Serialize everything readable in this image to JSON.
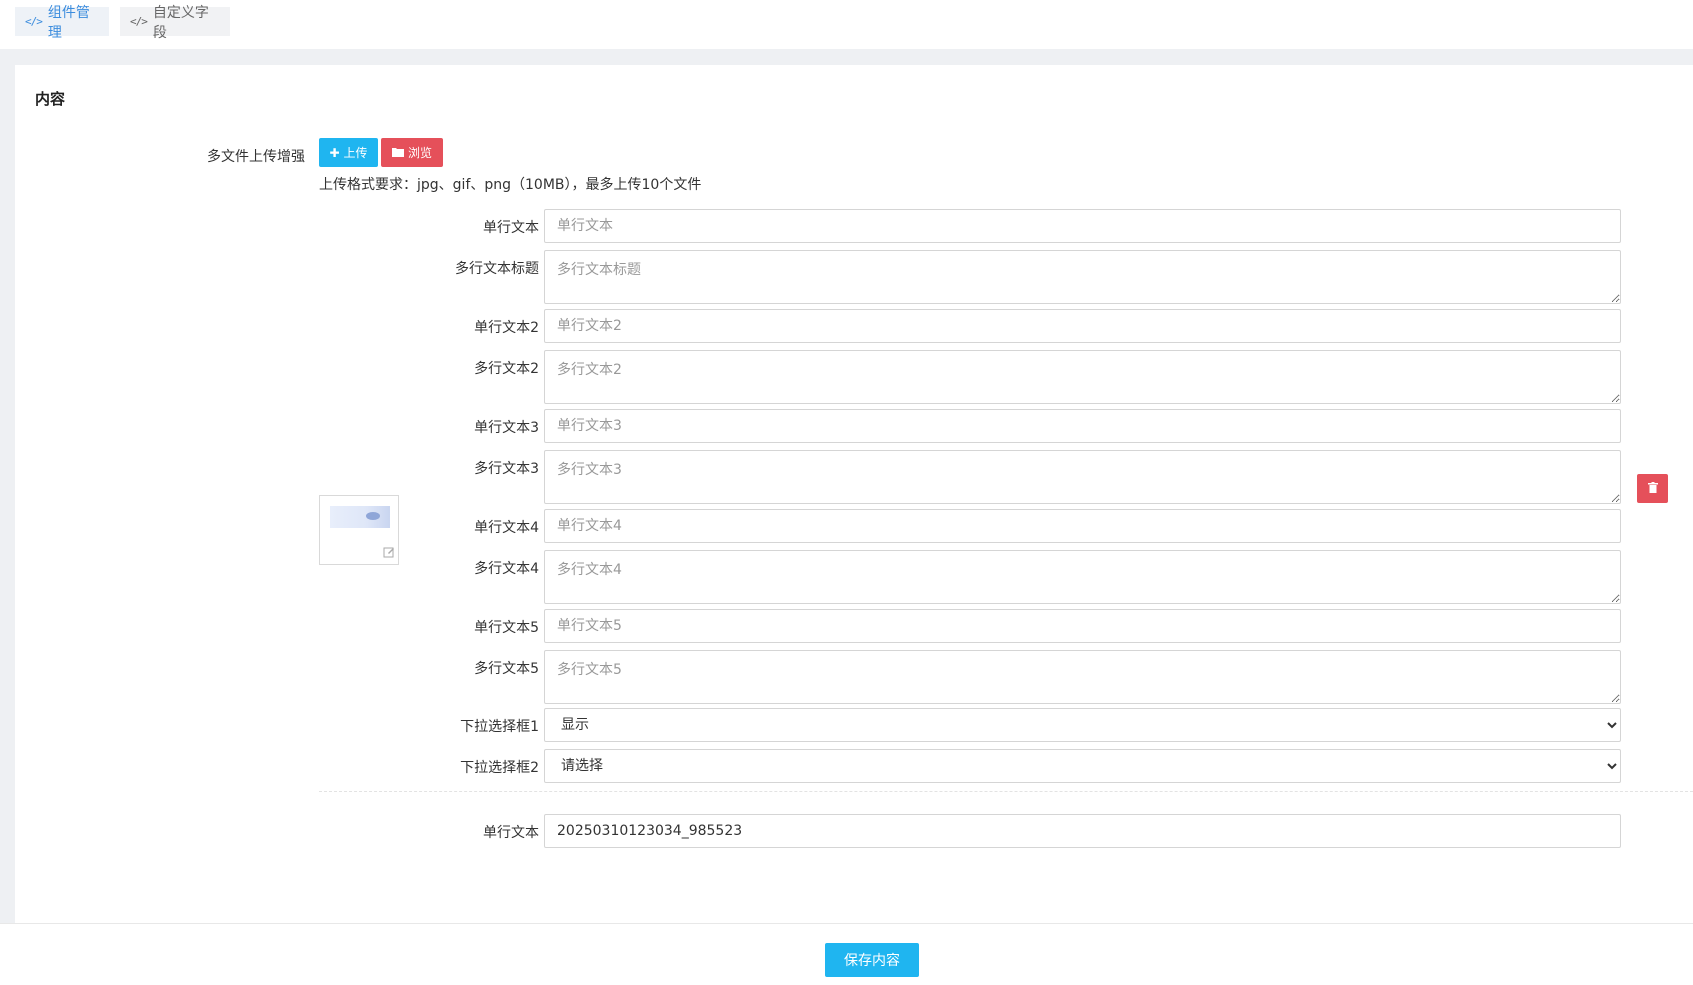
{
  "tabs": [
    {
      "label": "组件管理",
      "icon": "code-icon"
    },
    {
      "label": "自定义字段",
      "icon": "code-icon"
    }
  ],
  "panel": {
    "title": "内容",
    "upload": {
      "label": "多文件上传增强",
      "upload_button": "上传",
      "browse_button": "浏览",
      "hint": "上传格式要求：jpg、gif、png（10MB），最多上传10个文件"
    },
    "fields": [
      {
        "label": "单行文本",
        "type": "input",
        "placeholder": "单行文本",
        "value": ""
      },
      {
        "label": "多行文本标题",
        "type": "textarea",
        "placeholder": "多行文本标题",
        "value": ""
      },
      {
        "label": "单行文本2",
        "type": "input",
        "placeholder": "单行文本2",
        "value": ""
      },
      {
        "label": "多行文本2",
        "type": "textarea",
        "placeholder": "多行文本2",
        "value": ""
      },
      {
        "label": "单行文本3",
        "type": "input",
        "placeholder": "单行文本3",
        "value": ""
      },
      {
        "label": "多行文本3",
        "type": "textarea",
        "placeholder": "多行文本3",
        "value": ""
      },
      {
        "label": "单行文本4",
        "type": "input",
        "placeholder": "单行文本4",
        "value": ""
      },
      {
        "label": "多行文本4",
        "type": "textarea",
        "placeholder": "多行文本4",
        "value": ""
      },
      {
        "label": "单行文本5",
        "type": "input",
        "placeholder": "单行文本5",
        "value": ""
      },
      {
        "label": "多行文本5",
        "type": "textarea",
        "placeholder": "多行文本5",
        "value": ""
      },
      {
        "label": "下拉选择框1",
        "type": "select",
        "value": "显示"
      },
      {
        "label": "下拉选择框2",
        "type": "select",
        "value": "请选择"
      }
    ],
    "bottom_field": {
      "label": "单行文本",
      "value": "20250310123034_985523"
    }
  },
  "footer": {
    "save_button": "保存内容"
  },
  "colors": {
    "primary": "#1fb5f0",
    "danger": "#e5505a",
    "tab_active": "#3c8dde"
  }
}
